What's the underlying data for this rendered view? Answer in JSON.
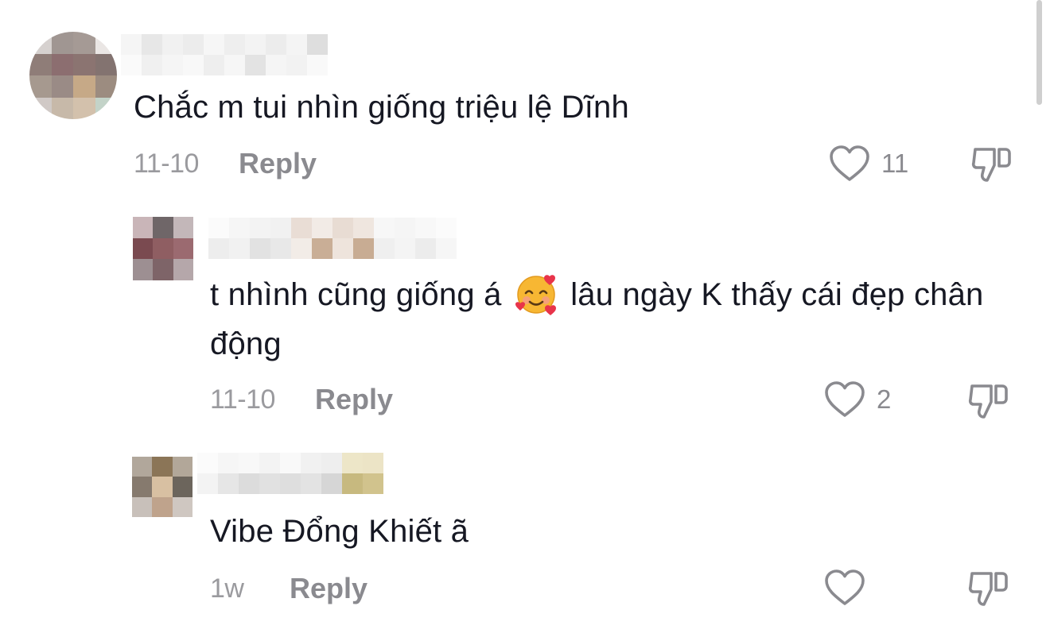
{
  "comments": [
    {
      "text": "Chắc m tui nhìn giống triệu lệ Dĩnh",
      "date": "11-10",
      "reply_label": "Reply",
      "likes": "11"
    },
    {
      "text_before_emoji": "t nhình cũng giống á",
      "emoji": "smiling-face-with-hearts",
      "text_after_emoji": "lâu ngày K thấy cái đẹp chân động",
      "date": "11-10",
      "reply_label": "Reply",
      "likes": "2"
    },
    {
      "text": "Vibe Đổng Khiết ã",
      "date": "1w",
      "reply_label": "Reply",
      "likes": ""
    }
  ],
  "icons": {
    "like": "heart-outline-icon",
    "dislike": "thumbs-down-outline-icon"
  },
  "colors": {
    "text": "#161823",
    "meta": "#8a8a8f",
    "scrollbar": "#cfcfcf"
  }
}
